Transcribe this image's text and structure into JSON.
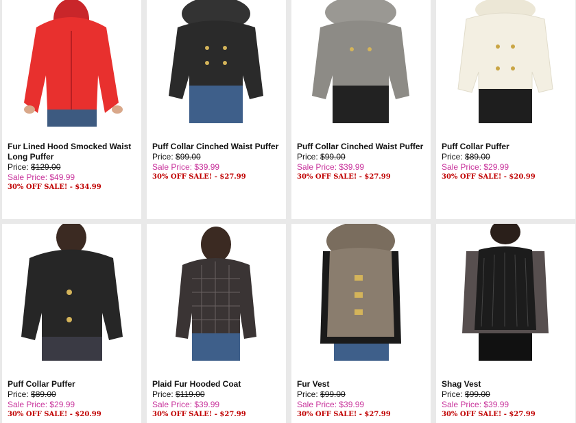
{
  "products": [
    {
      "name": "Fur Lined Hood Smocked Waist Long Puffer",
      "price_label": "Price:",
      "price": "$129.00",
      "sale_label": "Sale Price:",
      "sale_price": "$49.99",
      "deal": "30% OFF SALE! - $34.99",
      "jacket_color": "#e8302e"
    },
    {
      "name": "Puff Collar Cinched Waist Puffer",
      "price_label": "Price:",
      "price": "$99.00",
      "sale_label": "Sale Price:",
      "sale_price": "$39.99",
      "deal": "30% OFF SALE! - $27.99",
      "jacket_color": "#2a2a2a"
    },
    {
      "name": "Puff Collar Cinched Waist Puffer",
      "price_label": "Price:",
      "price": "$99.00",
      "sale_label": "Sale Price:",
      "sale_price": "$39.99",
      "deal": "30% OFF SALE! - $27.99",
      "jacket_color": "#8d8b86"
    },
    {
      "name": "Puff Collar Puffer",
      "price_label": "Price:",
      "price": "$89.00",
      "sale_label": "Sale Price:",
      "sale_price": "$29.99",
      "deal": "30% OFF SALE! - $20.99",
      "jacket_color": "#f3efe2"
    },
    {
      "name": "Puff Collar Puffer",
      "price_label": "Price:",
      "price": "$89.00",
      "sale_label": "Sale Price:",
      "sale_price": "$29.99",
      "deal": "30% OFF SALE! - $20.99",
      "jacket_color": "#262626"
    },
    {
      "name": "Plaid Fur Hooded Coat",
      "price_label": "Price:",
      "price": "$119.00",
      "sale_label": "Sale Price:",
      "sale_price": "$39.99",
      "deal": "30% OFF SALE! - $27.99",
      "jacket_color": "#3a3434"
    },
    {
      "name": "Fur Vest",
      "price_label": "Price:",
      "price": "$99.00",
      "sale_label": "Sale Price:",
      "sale_price": "$39.99",
      "deal": "30% OFF SALE! - $27.99",
      "jacket_color": "#8a7d6e"
    },
    {
      "name": "Shag Vest",
      "price_label": "Price:",
      "price": "$99.00",
      "sale_label": "Sale Price:",
      "sale_price": "$39.99",
      "deal": "30% OFF SALE! - $27.99",
      "jacket_color": "#1c1c1c"
    }
  ],
  "colors": {
    "sale": "#c8329b",
    "deal": "#c00000",
    "background": "#e9e9e9"
  }
}
